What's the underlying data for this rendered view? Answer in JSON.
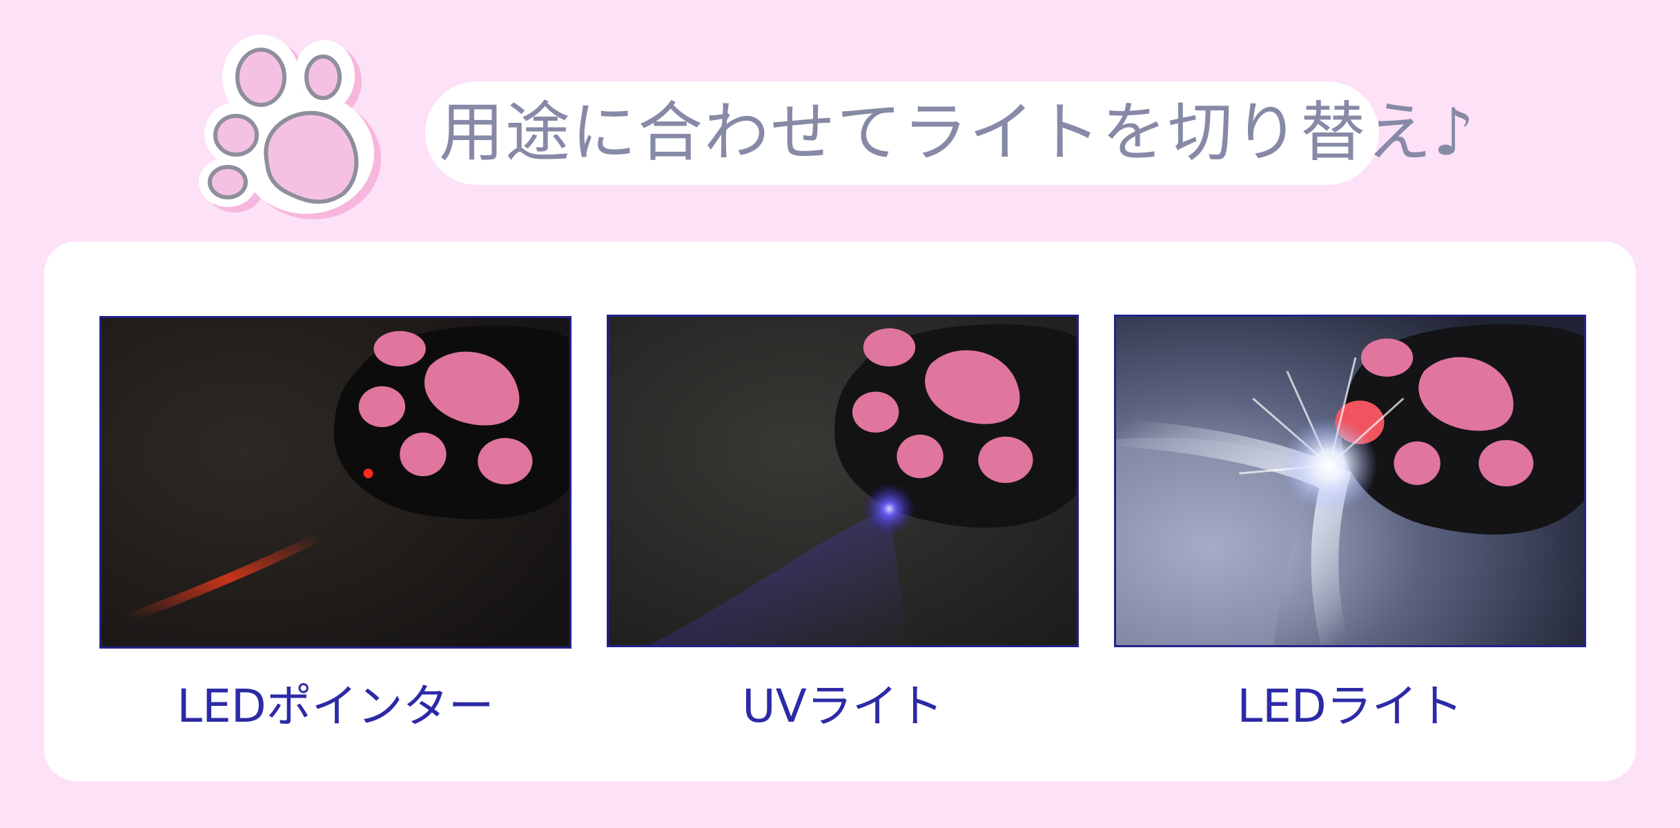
{
  "header": {
    "title": "用途に合わせてライトを切り替え♪",
    "logo_icon": "paw-print-icon"
  },
  "colors": {
    "background": "#fde1f6",
    "card": "#ffffff",
    "title_text": "#878aa6",
    "caption_text": "#2d2aa6",
    "paw_pad": "#e58ab0",
    "frame_border": "#23218c"
  },
  "modes": [
    {
      "label": "LEDポインター",
      "light": "red-laser-pointer"
    },
    {
      "label": "UVライト",
      "light": "uv-light"
    },
    {
      "label": "LEDライト",
      "light": "white-led-light"
    }
  ]
}
